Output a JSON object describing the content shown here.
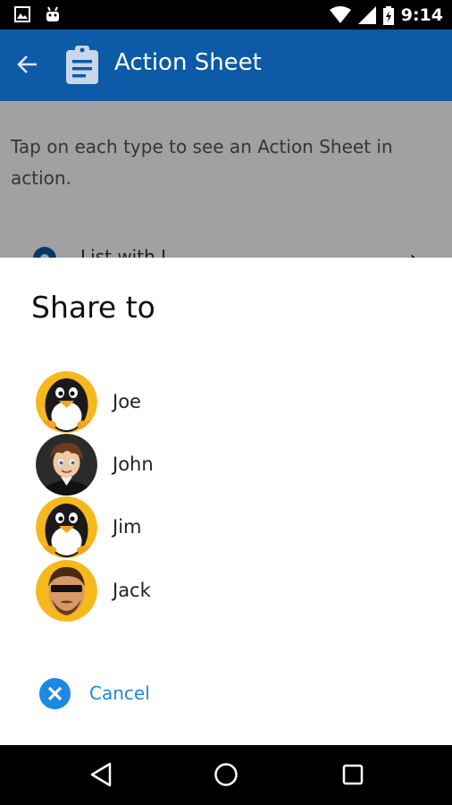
{
  "status_bar": {
    "time": "9:14",
    "icons": [
      "image-notification-icon",
      "android-notification-icon",
      "wifi-icon",
      "signal-icon",
      "battery-charging-icon"
    ]
  },
  "app_bar": {
    "title": "Action Sheet",
    "back_icon": "arrow-back-icon",
    "title_icon": "clipboard-icon",
    "color": "#0d5aa7"
  },
  "page": {
    "intro": "Tap on each type to see an Action Sheet in action.",
    "list_item_label": "List with I..."
  },
  "sheet": {
    "title": "Share to",
    "people": [
      {
        "name": "Joe",
        "avatar": "penguin-avatar"
      },
      {
        "name": "John",
        "avatar": "boy-avatar"
      },
      {
        "name": "Jim",
        "avatar": "penguin-avatar"
      },
      {
        "name": "Jack",
        "avatar": "sunglasses-man-avatar"
      }
    ],
    "cancel_label": "Cancel",
    "accent": "#1e88e5"
  },
  "nav_bar": {
    "buttons": [
      "back-triangle-icon",
      "home-circle-icon",
      "recents-square-icon"
    ]
  }
}
